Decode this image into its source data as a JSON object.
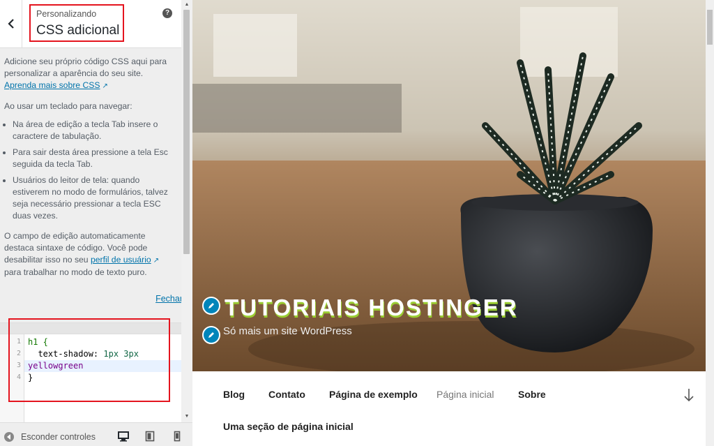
{
  "header": {
    "subtitle": "Personalizando",
    "title": "CSS adicional",
    "help_glyph": "?"
  },
  "description": {
    "intro": "Adicione seu próprio código CSS aqui para personalizar a aparência do seu site.",
    "learn_more_link": "Aprenda mais sobre CSS",
    "keyboard_intro": "Ao usar um teclado para navegar:",
    "bullets": [
      "Na área de edição a tecla Tab insere o caractere de tabulação.",
      "Para sair desta área pressione a tela Esc seguida da tecla Tab.",
      "Usuários do leitor de tela: quando estiverem no modo de formulários, talvez seja necessário pressionar a tecla ESC duas vezes."
    ],
    "syntax_text_before": "O campo de edição automaticamente destaca sintaxe de código. Você pode desabilitar isso no seu ",
    "profile_link": "perfil de usuário",
    "syntax_text_after": " para trabalhar no modo de texto puro.",
    "close_link": "Fechar"
  },
  "editor": {
    "line_numbers": [
      "1",
      "2",
      "3",
      "4"
    ],
    "lines": [
      "h1 {",
      "  text-shadow: 1px 3px",
      "yellowgreen",
      "}"
    ]
  },
  "footer": {
    "collapse_label": "Esconder controles",
    "devices": [
      "desktop",
      "tablet",
      "mobile"
    ]
  },
  "preview": {
    "site_title": "TUTORIAIS HOSTINGER",
    "site_description": "Só mais um site WordPress",
    "menu": [
      "Blog",
      "Contato",
      "Página de exemplo",
      "Página inicial",
      "Sobre"
    ],
    "menu_current": "Página inicial",
    "menu_second_row": "Uma seção de página inicial"
  },
  "colors": {
    "accent": "#0073aa",
    "highlight_box": "#e4141e",
    "edit_shortcut": "#0085ba",
    "title_shadow": "yellowgreen"
  },
  "icons": [
    "chevron-left-icon",
    "help-icon",
    "external-link-icon",
    "pencil-icon",
    "arrow-down-icon",
    "desktop-icon",
    "tablet-icon",
    "mobile-icon",
    "collapse-icon"
  ]
}
